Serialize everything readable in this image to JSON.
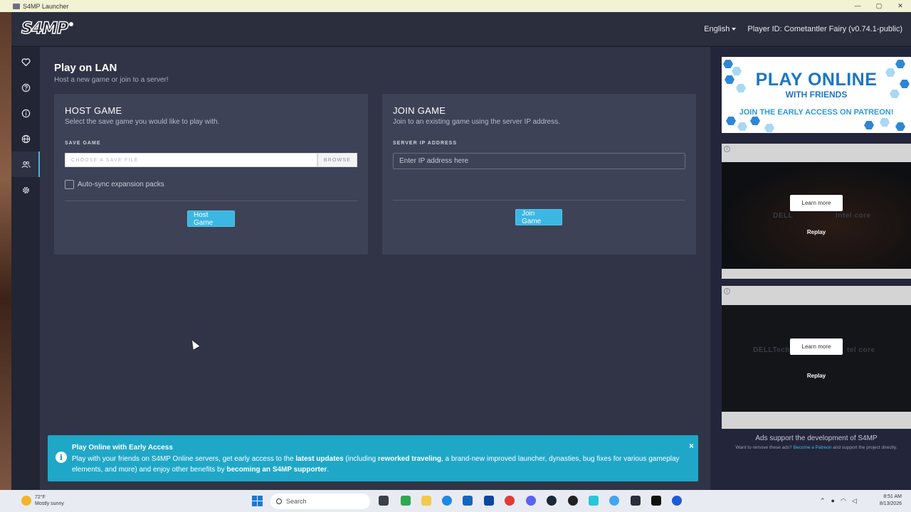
{
  "window": {
    "title": "S4MP Launcher",
    "controls": [
      "—",
      "▢",
      "✕"
    ]
  },
  "header": {
    "logo_text": "S4MP",
    "language": "English",
    "player_id": "Player ID: Cometantler Fairy (v0.74.1-public)"
  },
  "sidebar": {
    "items": [
      {
        "icon": "heart-icon",
        "active": false
      },
      {
        "icon": "help-icon",
        "active": false
      },
      {
        "icon": "info-icon",
        "active": false
      },
      {
        "icon": "globe-icon",
        "active": false
      },
      {
        "icon": "users-icon",
        "active": true
      },
      {
        "icon": "gear-icon",
        "active": false
      }
    ]
  },
  "page": {
    "title": "Play on LAN",
    "subtitle": "Host a new game or join to a server!"
  },
  "host": {
    "title": "HOST GAME",
    "description": "Select the save game you would like to play with.",
    "label": "SAVE GAME",
    "file_placeholder": "CHOOSE A SAVE FILE",
    "browse_label": "BROWSE",
    "checkbox_label": "Auto-sync expansion packs",
    "checkbox_checked": false,
    "button_label": "Host Game"
  },
  "join": {
    "title": "JOIN GAME",
    "description": "Join to an existing game using the server IP address.",
    "label": "SERVER IP ADDRESS",
    "ip_placeholder": "Enter IP address here",
    "button_label": "Join Game"
  },
  "toast": {
    "title": "Play Online with Early Access",
    "body_1": "Play with your friends on S4MP Online servers",
    "body_2": ", get early access to the ",
    "body_3": "latest updates",
    "body_4": " (including ",
    "body_5": "reworked traveling",
    "body_6": ", a brand-new improved launcher, dynasties, bug fixes for various gameplay elements, and more) and enjoy other benefits by ",
    "body_7": "becoming an S4MP supporter",
    "body_8": ".",
    "close": "×"
  },
  "ads": {
    "banner_line1": "PLAY ONLINE",
    "banner_line2": "WITH FRIENDS",
    "banner_line3": "JOIN THE EARLY ACCESS ON PATREON!",
    "video1": {
      "learn_more": "Learn more",
      "replay": "Replay",
      "brand_left": "DELL",
      "brand_right": "intel core"
    },
    "video2": {
      "learn_more": "Learn more",
      "replay": "Replay",
      "brand_left": "DELLTech",
      "brand_right": "tel core"
    },
    "note": "Ads support the development of S4MP",
    "sub_1": "Want to remove these ads? ",
    "sub_link": "Become a Patreon",
    "sub_2": " and support the project directly."
  },
  "taskbar": {
    "temperature": "72°F",
    "weather": "Mostly sunny",
    "search_placeholder": "Search",
    "time": "8:51 AM",
    "date": "8/13/2026"
  },
  "colors": {
    "accent": "#3cb6e3",
    "toast": "#1fa7c8",
    "panel": "#313446",
    "card": "#3e4256"
  }
}
